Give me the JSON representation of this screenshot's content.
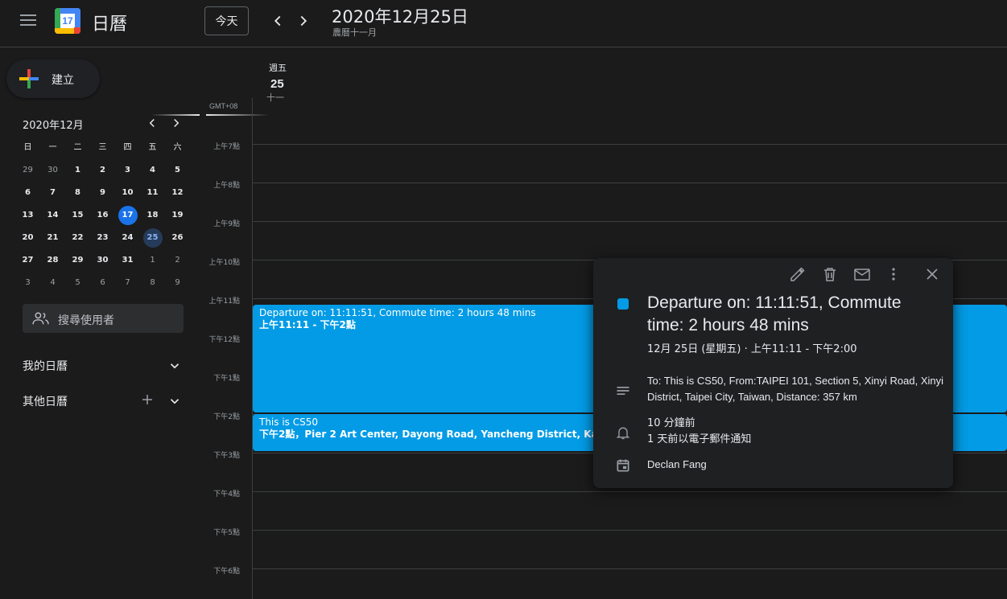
{
  "app": {
    "title": "日曆",
    "logo_day": "17"
  },
  "header": {
    "today_label": "今天",
    "prev_icon": "chevron-left-icon",
    "next_icon": "chevron-right-icon",
    "date_title": "2020年12月25日",
    "lunar_subtitle": "農曆十一月"
  },
  "sidebar": {
    "create_label": "建立",
    "mini_calendar": {
      "title": "2020年12月",
      "weekdays": [
        "日",
        "一",
        "二",
        "三",
        "四",
        "五",
        "六"
      ],
      "weeks": [
        [
          "29",
          "30",
          "1",
          "2",
          "3",
          "4",
          "5"
        ],
        [
          "6",
          "7",
          "8",
          "9",
          "10",
          "11",
          "12"
        ],
        [
          "13",
          "14",
          "15",
          "16",
          "17",
          "18",
          "19"
        ],
        [
          "20",
          "21",
          "22",
          "23",
          "24",
          "25",
          "26"
        ],
        [
          "27",
          "28",
          "29",
          "30",
          "31",
          "1",
          "2"
        ],
        [
          "3",
          "4",
          "5",
          "6",
          "7",
          "8",
          "9"
        ]
      ],
      "today": "17",
      "selected": "25"
    },
    "search_users_placeholder": "搜尋使用者",
    "my_calendars_label": "我的日曆",
    "other_calendars_label": "其他日曆"
  },
  "day_view": {
    "day_of_week": "週五",
    "day_number": "25",
    "lunar_day": "十一",
    "timezone": "GMT+08",
    "hours": [
      "上午7點",
      "上午8點",
      "上午9點",
      "上午10點",
      "上午11點",
      "下午12點",
      "下午1點",
      "下午2點",
      "下午3點",
      "下午4點",
      "下午5點",
      "下午6點"
    ]
  },
  "events": [
    {
      "title": "Departure on: 11:11:51, Commute time: 2 hours 48 mins",
      "time": "上午11:11 - 下午2點",
      "color": "#039be5"
    },
    {
      "title": "This is CS50",
      "time": "下午2點，Pier 2 Art Center, Dayong Road, Yancheng District, Kaohsiung City, Taiwan",
      "color": "#039be5"
    }
  ],
  "popup": {
    "title": "Departure on: 11:11:51, Commute time: 2 hours 48 mins",
    "when": "12月 25日 (星期五)  ·  上午11:11 - 下午2:00",
    "description": "To: This is CS50, From:TAIPEI 101, Section 5, Xinyi Road, Xinyi District, Taipei City, Taiwan, Distance: 357 km",
    "reminder_1": "10 分鐘前",
    "reminder_2": "1 天前以電子郵件通知",
    "owner": "Declan Fang",
    "actions": [
      "edit-icon",
      "delete-icon",
      "email-icon",
      "more-icon",
      "close-icon"
    ]
  }
}
